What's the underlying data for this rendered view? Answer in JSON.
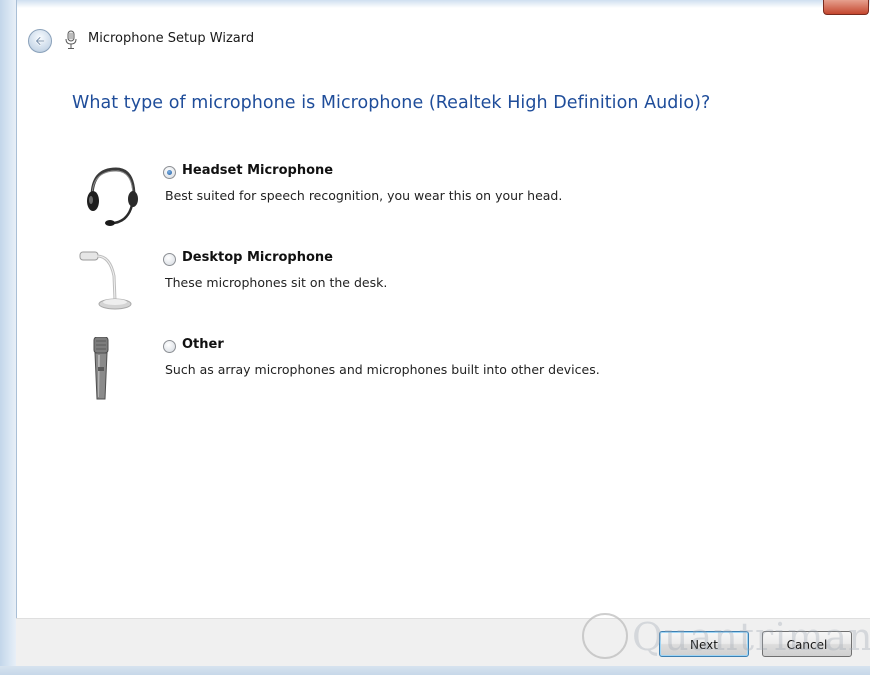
{
  "window": {
    "title": "Microphone Setup Wizard",
    "back_icon": "back-arrow-icon",
    "app_icon": "microphone-icon"
  },
  "heading": "What type of microphone is Microphone (Realtek High Definition Audio)?",
  "options": [
    {
      "title": "Headset Microphone",
      "description": "Best suited for speech recognition, you wear this on your head.",
      "icon": "headset-icon",
      "selected": true
    },
    {
      "title": "Desktop Microphone",
      "description": "These microphones sit on the desk.",
      "icon": "desktop-microphone-icon",
      "selected": false
    },
    {
      "title": "Other",
      "description": "Such as array microphones and microphones built into other devices.",
      "icon": "handheld-microphone-icon",
      "selected": false
    }
  ],
  "buttons": {
    "next": "Next",
    "cancel": "Cancel"
  },
  "watermark": "Quantrimang",
  "colors": {
    "heading": "#1f4d9a",
    "frame": "#c3d6ea",
    "footer": "#f0f0f0"
  }
}
